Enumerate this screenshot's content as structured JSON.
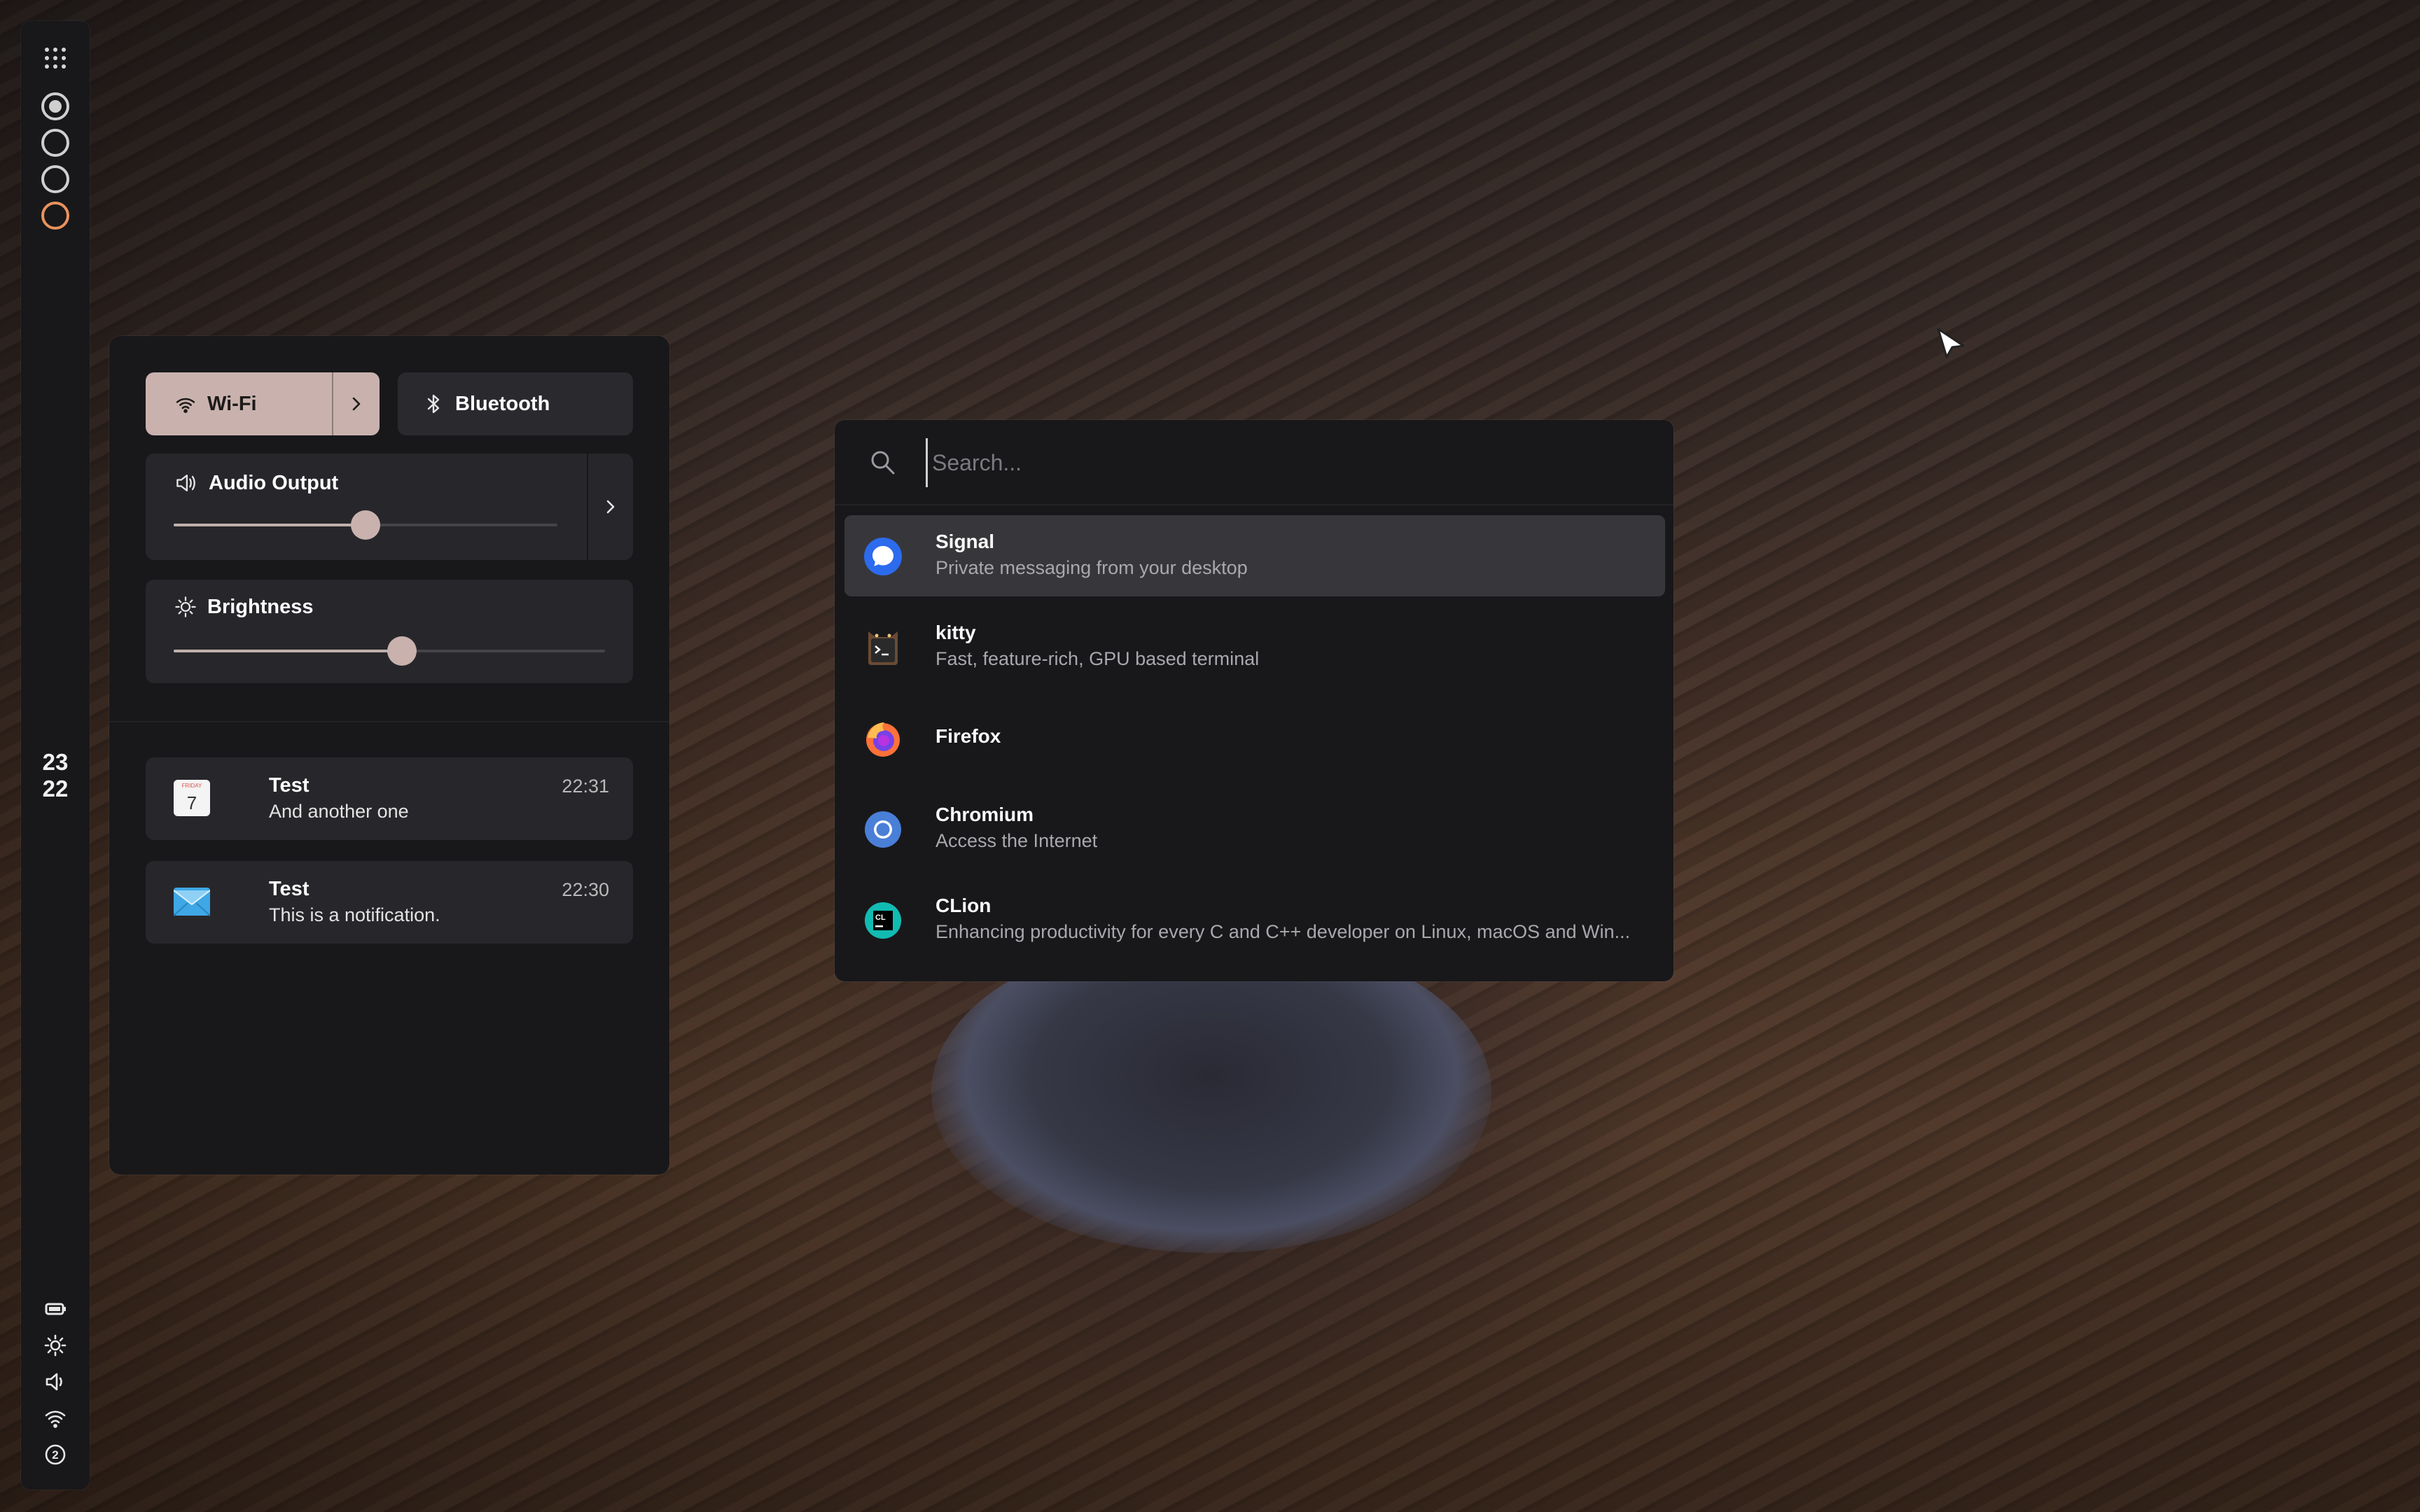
{
  "sidebar": {
    "clock": {
      "hour": "23",
      "minute": "22"
    },
    "workspaces": [
      {
        "name": "workspace-1",
        "state": "active"
      },
      {
        "name": "workspace-2",
        "state": "inactive"
      },
      {
        "name": "workspace-3",
        "state": "inactive"
      },
      {
        "name": "workspace-4",
        "state": "urgent",
        "color": "#e8925c"
      }
    ],
    "status_icons": [
      "battery-icon",
      "brightness-icon",
      "volume-icon",
      "wifi-icon",
      "notification-count-icon"
    ],
    "notification_count": "2"
  },
  "control_panel": {
    "wifi_label": "Wi-Fi",
    "bluetooth_label": "Bluetooth",
    "audio": {
      "label": "Audio Output",
      "level": 0.5
    },
    "brightness": {
      "label": "Brightness",
      "level": 0.53
    },
    "notifications": [
      {
        "app_icon": "calendar-icon",
        "calendar_day": "FRIDAY",
        "calendar_date": "7",
        "title": "Test",
        "body": "And another one",
        "time": "22:31"
      },
      {
        "app_icon": "mail-icon",
        "title": "Test",
        "body": "This is a notification.",
        "time": "22:30"
      }
    ]
  },
  "launcher": {
    "search_placeholder": "Search...",
    "apps": [
      {
        "name": "Signal",
        "description": "Private messaging from your desktop",
        "icon": "signal-icon",
        "selected": true
      },
      {
        "name": "kitty",
        "description": "Fast, feature-rich, GPU based terminal",
        "icon": "kitty-icon"
      },
      {
        "name": "Firefox",
        "description": "",
        "icon": "firefox-icon"
      },
      {
        "name": "Chromium",
        "description": "Access the Internet",
        "icon": "chromium-icon"
      },
      {
        "name": "CLion",
        "description": "Enhancing productivity for every C and C++ developer on Linux, macOS and Win...",
        "icon": "clion-icon"
      }
    ]
  },
  "colors": {
    "accent": "#c9b2ad",
    "panel": "#18181b",
    "card": "#27272b",
    "urgent": "#e8925c"
  }
}
